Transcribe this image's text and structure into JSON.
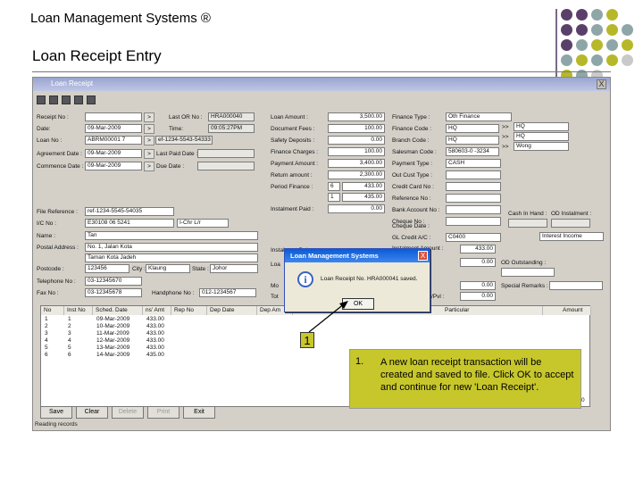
{
  "slide": {
    "title": "Loan Management Systems ®",
    "subtitle": "Loan Receipt Entry",
    "accent_purple": "#5b3f6b",
    "accent_olive": "#b7b829",
    "accent_grey": "#8fa6a8"
  },
  "window": {
    "title": "Loan Receipt",
    "close": "X"
  },
  "form": {
    "receipt_no_label": "Receipt No :",
    "date_label": "Date:",
    "date_value": "09-Mar-2009",
    "time_label": "Time:",
    "time_value": "09:05:27PM",
    "loan_no_label": "Loan No :",
    "loan_no_value": "ABRM00001 7",
    "loan_no_extra": "ef-1234-5543-54333",
    "agreement_label": "Agreement Date :",
    "agreement_value": "09-Mar-2009",
    "last_paid_label": "Last Paid Date :",
    "commence_label": "Commence Date :",
    "commence_value": "09-Mar-2009",
    "due_date_label": "Due Date :",
    "last_or_label": "Last OR No :",
    "last_or_value": "HRA000040",
    "file_ref_label": "File Reference :",
    "file_ref_value": "ref-1234-5545-54035",
    "ic_label": "I/C No :",
    "ic_value": "E30108 06 5241",
    "ic_type": "I-Chr L/r",
    "name_label": "Name :",
    "name_value": "Tan",
    "addr_label": "Postal Address :",
    "addr1": "No. 1, Jalan Kota",
    "addr2": "Taman Kota Jadeh",
    "postcode_label": "Postcode :",
    "postcode_value": "123456",
    "city_label": "City :",
    "city_value": "Klaung",
    "state_label": "State :",
    "state_value": "Johor",
    "tel_label": "Telephone No :",
    "tel_value": "03-12345670",
    "fax_label": "Fax No :",
    "fax_value": "03-12345678",
    "hp_label": "Handphone No :",
    "hp_value": "012-1234567",
    "loan_amount_label": "Loan Amount :",
    "loan_amount_value": "3,500.00",
    "doc_fees_label": "Document Fees :",
    "doc_fees_value": "100.00",
    "safety_label": "Safety Deposits :",
    "safety_value": "0.00",
    "finance_charges_label": "Finance Charges :",
    "finance_charges_value": "100.00",
    "payment_amount_label": "Payment Amount :",
    "payment_amount_value": "3,400.00",
    "return_amount_label": "Return amount :",
    "return_amount_value": "2,300.00",
    "period_label": "Period Finance :",
    "period_value1": "6",
    "period_amount1": "433.00",
    "period_value2": "1",
    "period_amount2": "435.00",
    "instalment_label": "Instalment Paid :",
    "instalment_value": "0.00",
    "finance_type_label": "Finance Type :",
    "finance_type_value": "Oth Finance",
    "finance_code_label": "Finance Code :",
    "finance_code_value": "HQ",
    "finance_code_desc": "HQ",
    "branch_label": "Branch Code :",
    "branch_value": "HQ",
    "branch_desc": "HQ",
    "salesman_label": "Salesman Code :",
    "salesman_value": "580603-0 -3234",
    "salesman_desc": "Wong",
    "payment_type_label": "Payment Type :",
    "payment_type_value": "CASH",
    "out_cust_label": "Out Cust Type :",
    "credit_card_label": "Credit Card No :",
    "ref_no_label": "Reference No :",
    "bank_acc_label": "Bank Account No :",
    "cheque_label": "Cheque No :",
    "cash_in_hand_label": "Cash In Hand :",
    "od_label": "OD Instalment :",
    "cheque_date_label": "Cheque Date :",
    "gl_label": "GL Credit A/C :",
    "gl_value": "C0400",
    "gl_desc": "Interest Income",
    "instal_balance_label": "Instalment Balance :",
    "instal_amount_label": "Instalment Amount :",
    "instal_amount_value": "433.00",
    "loa_label": "Loa",
    "loa_value": "0.00",
    "od_outstanding_label": "OD Outstanding :",
    "mo_label": "Mo",
    "mo_value": "0.00",
    "special_remarks_label": "Special Remarks :",
    "tot_label": "Tot",
    "tot_value": "0.00",
    "pv_label": "/Pvl :",
    "pv_value": "0.00"
  },
  "grid": {
    "headers": [
      "No",
      "Inst No",
      "Sched. Date",
      "ns' Amt",
      "Rep No",
      "Dep Date",
      "Dep Am"
    ],
    "right_headers": [
      "Particular",
      "Amount"
    ],
    "rows": [
      {
        "no": "1",
        "inst": "1",
        "date": "09-Mar-2009",
        "amt": "433.00"
      },
      {
        "no": "2",
        "inst": "2",
        "date": "10-Mar-2009",
        "amt": "433.00"
      },
      {
        "no": "3",
        "inst": "3",
        "date": "11-Mar-2009",
        "amt": "433.00"
      },
      {
        "no": "4",
        "inst": "4",
        "date": "12-Mar-2009",
        "amt": "433.00"
      },
      {
        "no": "5",
        "inst": "5",
        "date": "13-Mar-2009",
        "amt": "433.00"
      },
      {
        "no": "6",
        "inst": "6",
        "date": "14-Mar-2009",
        "amt": "435.00"
      }
    ],
    "total_value": "0.00"
  },
  "buttons": {
    "save": "Save",
    "clear": "Clear",
    "delete": "Delete",
    "print": "Print",
    "exit": "Exit"
  },
  "status": "Reading records",
  "dialog": {
    "title": "Loan Management Systems",
    "message": "Loan Receipt No. HRA000041 saved.",
    "ok": "OK",
    "close": "X"
  },
  "callout": {
    "marker": "1",
    "number": "1.",
    "text": "A new loan receipt transaction will be created and saved to file. Click OK to accept and continue for new 'Loan Receipt'."
  }
}
